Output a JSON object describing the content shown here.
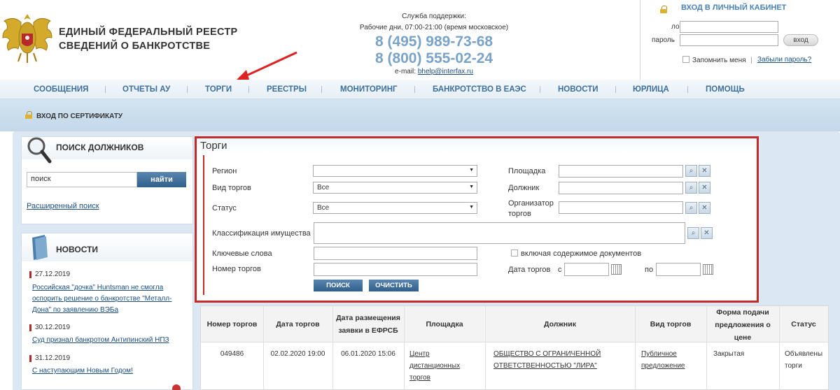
{
  "header": {
    "title_line1": "ЕДИНЫЙ ФЕДЕРАЛЬНЫЙ РЕЕСТР",
    "title_line2": "СВЕДЕНИЙ О БАНКРОТСТВЕ",
    "support_label": "Служба поддержки:",
    "work_hours": "Рабочие дни, 07:00-21:00 (время московское)",
    "phone1": "8 (495) 989-73-68",
    "phone2": "8 (800) 555-02-24",
    "email_label": "e-mail:",
    "email": "bhelp@interfax.ru"
  },
  "login": {
    "title": "ВХОД В ЛИЧНЫЙ КАБИНЕТ",
    "login_label": "логин",
    "password_label": "пароль",
    "login_button": "вход",
    "remember": "Запомнить меня",
    "separator": "|",
    "forgot": "Забыли пароль?"
  },
  "nav": {
    "items": [
      {
        "label": "СООБЩЕНИЯ"
      },
      {
        "label": "ОТЧЕТЫ АУ"
      },
      {
        "label": "ТОРГИ"
      },
      {
        "label": "РЕЕСТРЫ"
      },
      {
        "label": "МОНИТОРИНГ"
      },
      {
        "label": "БАНКРОТСТВО В ЕАЭС"
      },
      {
        "label": "НОВОСТИ"
      },
      {
        "label": "ЮРЛИЦА"
      },
      {
        "label": "ПОМОЩЬ"
      }
    ]
  },
  "cert_login": "ВХОД ПО СЕРТИФИКАТУ",
  "sidebar": {
    "search_title": "ПОИСК ДОЛЖНИКОВ",
    "search_value": "поиск",
    "search_button": "найти",
    "advanced_search": "Расширенный поиск",
    "news_title": "НОВОСТИ",
    "news": [
      {
        "date": "27.12.2019",
        "text": [
          "Российская \"дочка\" Huntsman не смогла",
          "оспорить решение о банкротстве \"Металл-",
          "Дона\" по заявлению ВЭБа"
        ]
      },
      {
        "date": "30.12.2019",
        "text": [
          "Суд признал банкротом Антипинский НПЗ"
        ]
      },
      {
        "date": "31.12.2019",
        "text": [
          "С наступающим Новым Годом!"
        ]
      }
    ]
  },
  "torgi": {
    "title": "Торги",
    "region_label": "Регион",
    "region_value": "",
    "type_label": "Вид торгов",
    "type_value": "Все",
    "status_label": "Статус",
    "status_value": "Все",
    "platform_label": "Площадка",
    "debtor_label": "Должник",
    "organizer_label_1": "Организатор",
    "organizer_label_2": "торгов",
    "classification_label": "Классификация имущества",
    "keywords_label": "Ключевые слова",
    "include_docs": "включая содержимое документов",
    "number_label": "Номер торгов",
    "date_label": "Дата торгов",
    "date_from": "с",
    "date_to": "по",
    "search_button": "ПОИСК",
    "clear_button": "ОЧИСТИТЬ"
  },
  "table": {
    "headers": {
      "number": "Номер торгов",
      "date": "Дата торгов",
      "placed_1": "Дата размещения",
      "placed_2": "заявки в ЕФРСБ",
      "platform": "Площадка",
      "debtor": "Должник",
      "type": "Вид торгов",
      "form_1": "Форма подачи",
      "form_2": "предложения о",
      "form_3": "цене",
      "status": "Статус"
    },
    "row": {
      "number": "049486",
      "date": "02.02.2020 19:00",
      "placed": "06.01.2020 15:06",
      "platform_1": "Центр",
      "platform_2": "дистанционных",
      "platform_3": "торгов",
      "debtor_1": "ОБЩЕСТВО С ОГРАНИЧЕННОЙ",
      "debtor_2": "ОТВЕТСТВЕННОСТЬЮ \"ЛИРА\"",
      "type_1": "Публичное",
      "type_2": "предложение",
      "form": "Закрытая",
      "status_1": "Объявлены",
      "status_2": "торги"
    }
  }
}
